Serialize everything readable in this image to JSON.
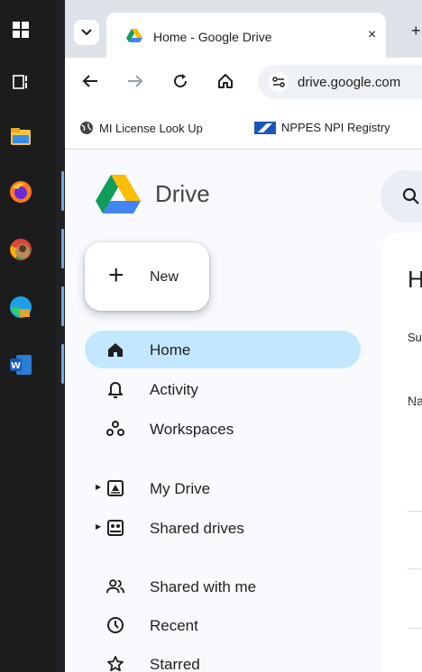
{
  "taskbar": {
    "items": [
      {
        "name": "windows-start-icon"
      },
      {
        "name": "task-view-icon"
      },
      {
        "name": "file-explorer-icon"
      },
      {
        "name": "firefox-icon"
      },
      {
        "name": "chrome-icon"
      },
      {
        "name": "edge-icon"
      },
      {
        "name": "word-icon"
      }
    ]
  },
  "browser": {
    "tab": {
      "title": "Home - Google Drive",
      "close": "×"
    },
    "new_tab": "+",
    "url": "drive.google.com",
    "bookmarks": [
      {
        "label": "MI License Look Up"
      },
      {
        "label": "NPPES NPI Registry"
      }
    ]
  },
  "drive": {
    "brand": "Drive",
    "new_button": "New",
    "nav": {
      "home": "Home",
      "activity": "Activity",
      "workspaces": "Workspaces",
      "my_drive": "My Drive",
      "shared_drives": "Shared drives",
      "shared_with_me": "Shared with me",
      "recent": "Recent",
      "starred": "Starred"
    },
    "main": {
      "heading_fragment": "H",
      "suggested_fragment": "Su",
      "name_fragment": "Na"
    }
  },
  "colors": {
    "active_nav": "#c2e7ff",
    "tabstrip": "#dee3ea",
    "page_bg": "#f8fafd"
  }
}
